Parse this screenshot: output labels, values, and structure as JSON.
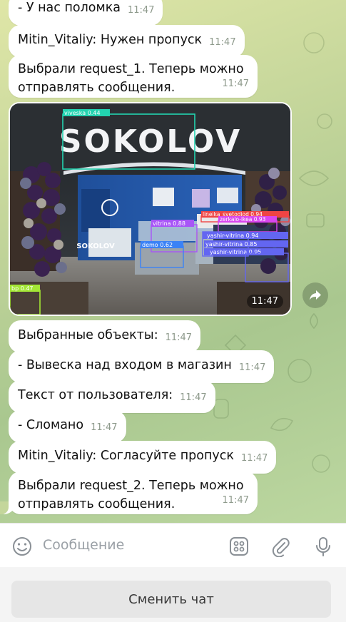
{
  "messages": [
    {
      "text": "- У нас поломка",
      "time": "11:47"
    },
    {
      "text": "Mitin_Vitaliy: Нужен пропуск",
      "time": "11:47"
    },
    {
      "text": "Выбрали request_1. Теперь можно отправлять сообщения.",
      "time": "11:47"
    },
    {
      "text": "Выбранные объекты:",
      "time": "11:47"
    },
    {
      "text": "- Вывеска над входом в магазин",
      "time": "11:47"
    },
    {
      "text": "Текст от пользователя:",
      "time": "11:47"
    },
    {
      "text": "- Сломано",
      "time": "11:47"
    },
    {
      "text": "Mitin_Vitaliy: Согласуйте пропуск",
      "time": "11:47"
    },
    {
      "text": "Выбрали request_2. Теперь можно отправлять сообщения.",
      "time": "11:47"
    }
  ],
  "photo": {
    "time": "11:47",
    "store_sign": "SOKOLOV",
    "inner_sign": "SOKOLOV",
    "detections": [
      {
        "label": "viveska 0.44",
        "color": "#22d3b0"
      },
      {
        "label": "vitrina 0.88",
        "color": "#a855f7"
      },
      {
        "label": "demo 0.62",
        "color": "#3b82f6"
      },
      {
        "label": "lineika_svetodiod 0.94",
        "color": "#ef4444"
      },
      {
        "label": "zerkalo-ikea 0.93",
        "color": "#d946ef"
      },
      {
        "label": "yashir-vitrina 0.94",
        "color": "#6366f1"
      },
      {
        "label": "yashir-vitrina 0.85",
        "color": "#6366f1"
      },
      {
        "label": "yashir-vitrina 0.95",
        "color": "#6366f1"
      },
      {
        "label": "bp 0.47",
        "color": "#a3e635"
      }
    ]
  },
  "composer": {
    "placeholder": "Сообщение",
    "icons": [
      "smile-icon",
      "keyboard-grid-icon",
      "paperclip-icon",
      "microphone-icon"
    ]
  },
  "bottom": {
    "switch_label": "Сменить чат"
  }
}
